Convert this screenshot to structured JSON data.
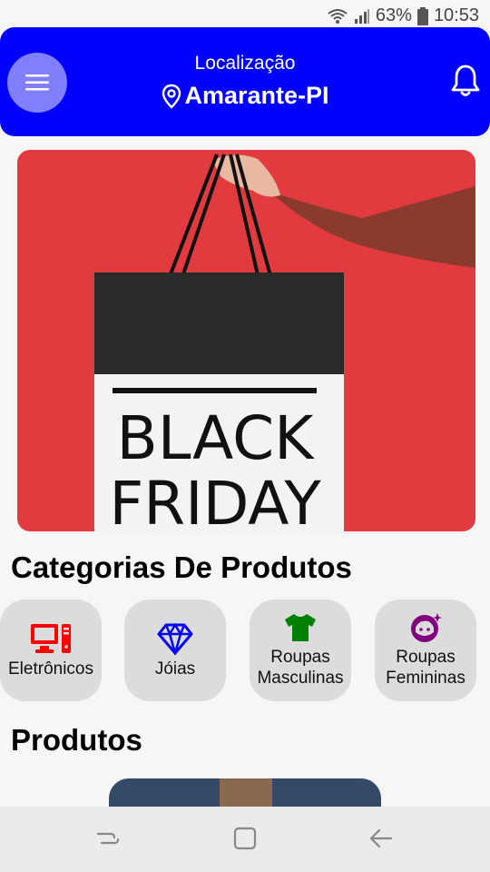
{
  "status_bar": {
    "battery": "63%",
    "time": "10:53"
  },
  "header": {
    "location_label": "Localização",
    "city": "Amarante-PI"
  },
  "banner": {
    "line1": "BLACK",
    "line2": "FRIDAY"
  },
  "sections": {
    "categories_title": "Categorias De Produtos",
    "products_title": "Produtos"
  },
  "categories": [
    {
      "label": "Eletrônicos",
      "icon": "computer-icon",
      "color": "#ff0000"
    },
    {
      "label": "Jóias",
      "icon": "diamond-icon",
      "color": "#0000ff"
    },
    {
      "label": "Roupas Masculinas",
      "icon": "tshirt-icon",
      "color": "#008000"
    },
    {
      "label": "Roupas Femininas",
      "icon": "woman-face-icon",
      "color": "#800080"
    }
  ],
  "colors": {
    "header": "#0000ff",
    "menu_button": "#8080ff",
    "banner_bg": "#e23b3f"
  }
}
